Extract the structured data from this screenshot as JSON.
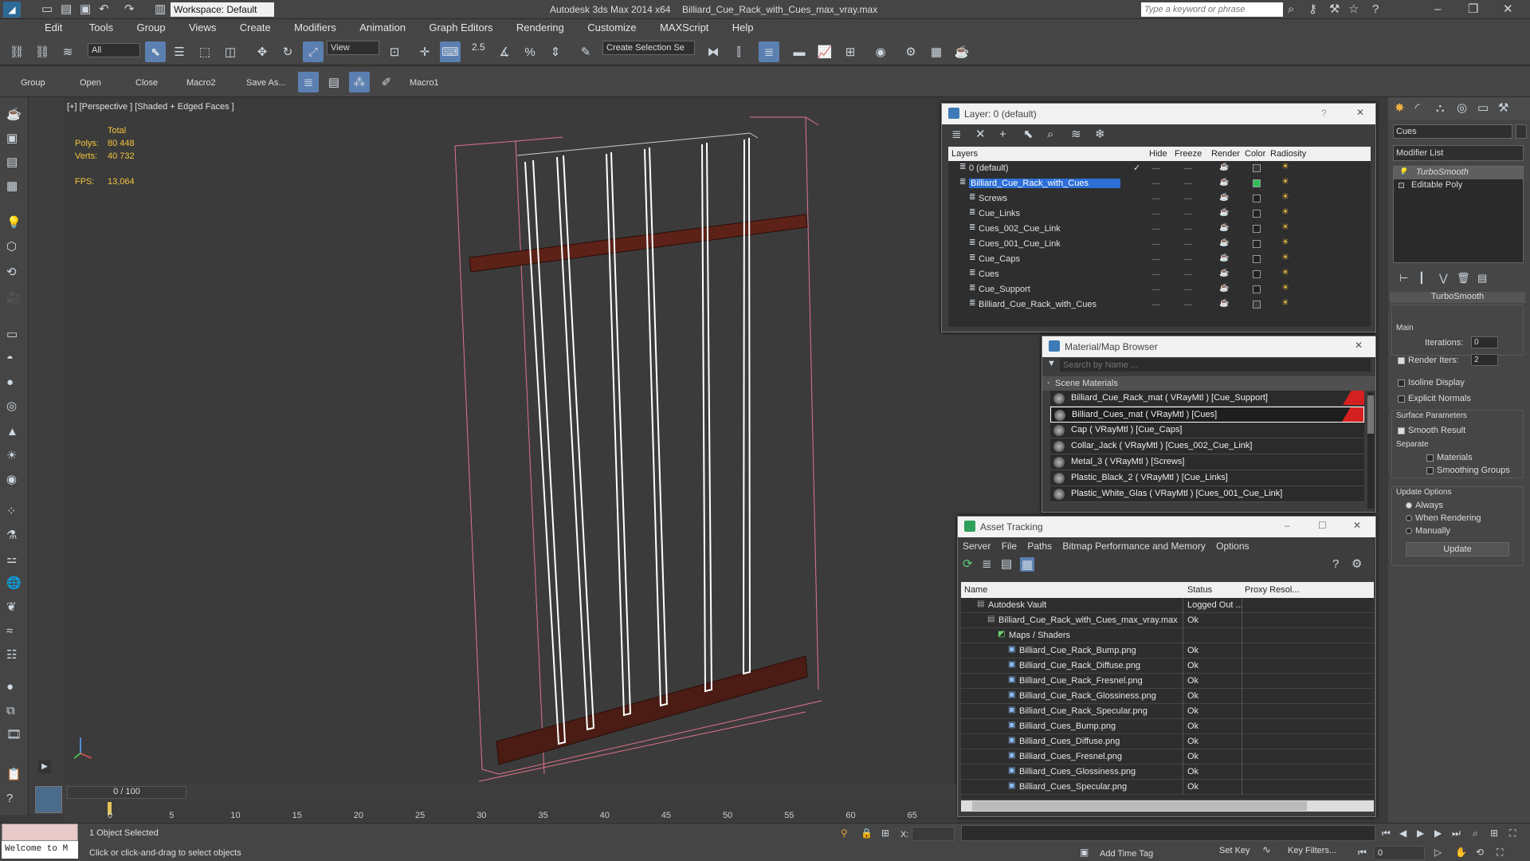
{
  "titlebar": {
    "app_title": "Autodesk 3ds Max  2014 x64",
    "file_title": "Billiard_Cue_Rack_with_Cues_max_vray.max",
    "workspace": "Workspace: Default",
    "search_placeholder": "Type a keyword or phrase"
  },
  "menu": [
    "Edit",
    "Tools",
    "Group",
    "Views",
    "Create",
    "Modifiers",
    "Animation",
    "Graph Editors",
    "Rendering",
    "Customize",
    "MAXScript",
    "Help"
  ],
  "toolbar": {
    "selection_filter": "All",
    "ref_coord": "View",
    "snap_value": "2.5",
    "named_selection": "Create Selection Se"
  },
  "ribbon": {
    "items": [
      "Group",
      "Open",
      "Close",
      "Macro2",
      "Save As...",
      "Macro1"
    ]
  },
  "viewport": {
    "label": "[+] [Perspective ] [Shaded + Edged Faces ]",
    "stats_header": "Total",
    "polys_label": "Polys:",
    "polys": "80 448",
    "verts_label": "Verts:",
    "verts": "40 732",
    "fps_label": "FPS:",
    "fps": "13,064"
  },
  "layer_window": {
    "title": "Layer: 0 (default)",
    "columns": [
      "Layers",
      "Hide",
      "Freeze",
      "Render",
      "Color",
      "Radiosity"
    ],
    "rows": [
      {
        "name": "0 (default)",
        "level": 0,
        "selected": false,
        "color": "#3a3a3a"
      },
      {
        "name": "Billiard_Cue_Rack_with_Cues",
        "level": 0,
        "selected": true,
        "color": "#2fbf5a"
      },
      {
        "name": "Screws",
        "level": 1,
        "selected": false,
        "color": "#222222"
      },
      {
        "name": "Cue_Links",
        "level": 1,
        "selected": false,
        "color": "#222222"
      },
      {
        "name": "Cues_002_Cue_Link",
        "level": 1,
        "selected": false,
        "color": "#222222"
      },
      {
        "name": "Cues_001_Cue_Link",
        "level": 1,
        "selected": false,
        "color": "#222222"
      },
      {
        "name": "Cue_Caps",
        "level": 1,
        "selected": false,
        "color": "#222222"
      },
      {
        "name": "Cues",
        "level": 1,
        "selected": false,
        "color": "#222222"
      },
      {
        "name": "Cue_Support",
        "level": 1,
        "selected": false,
        "color": "#222222"
      },
      {
        "name": "Billiard_Cue_Rack_with_Cues",
        "level": 1,
        "selected": false,
        "color": "#3a3a3a"
      }
    ]
  },
  "material_browser": {
    "title": "Material/Map Browser",
    "search_placeholder": "Search by Name ...",
    "section": "Scene Materials",
    "items": [
      {
        "label": "Billiard_Cue_Rack_mat  ( VRayMtl ) [Cue_Support]",
        "flag": true,
        "selected": false
      },
      {
        "label": "Billiard_Cues_mat  ( VRayMtl ) [Cues]",
        "flag": true,
        "selected": true
      },
      {
        "label": "Cap  ( VRayMtl ) [Cue_Caps]",
        "flag": false,
        "selected": false
      },
      {
        "label": "Collar_Jack  ( VRayMtl ) [Cues_002_Cue_Link]",
        "flag": false,
        "selected": false
      },
      {
        "label": "Metal_3  ( VRayMtl ) [Screws]",
        "flag": false,
        "selected": false
      },
      {
        "label": "Plastic_Black_2  ( VRayMtl ) [Cue_Links]",
        "flag": false,
        "selected": false
      },
      {
        "label": "Plastic_White_Glas  ( VRayMtl ) [Cues_001_Cue_Link]",
        "flag": false,
        "selected": false
      }
    ]
  },
  "asset_tracking": {
    "title": "Asset Tracking",
    "menu": [
      "Server",
      "File",
      "Paths",
      "Bitmap Performance and Memory",
      "Options"
    ],
    "columns": [
      "Name",
      "Status",
      "Proxy Resol..."
    ],
    "rows": [
      {
        "name": "Autodesk Vault",
        "status": "Logged Out ...",
        "level": 0
      },
      {
        "name": "Billiard_Cue_Rack_with_Cues_max_vray.max",
        "status": "Ok",
        "level": 1
      },
      {
        "name": "Maps / Shaders",
        "status": "",
        "level": 2
      },
      {
        "name": "Billiard_Cue_Rack_Bump.png",
        "status": "Ok",
        "level": 3
      },
      {
        "name": "Billiard_Cue_Rack_Diffuse.png",
        "status": "Ok",
        "level": 3
      },
      {
        "name": "Billiard_Cue_Rack_Fresnel.png",
        "status": "Ok",
        "level": 3
      },
      {
        "name": "Billiard_Cue_Rack_Glossiness.png",
        "status": "Ok",
        "level": 3
      },
      {
        "name": "Billiard_Cue_Rack_Specular.png",
        "status": "Ok",
        "level": 3
      },
      {
        "name": "Billiard_Cues_Bump.png",
        "status": "Ok",
        "level": 3
      },
      {
        "name": "Billiard_Cues_Diffuse.png",
        "status": "Ok",
        "level": 3
      },
      {
        "name": "Billiard_Cues_Fresnel.png",
        "status": "Ok",
        "level": 3
      },
      {
        "name": "Billiard_Cues_Glossiness.png",
        "status": "Ok",
        "level": 3
      },
      {
        "name": "Billiard_Cues_Specular.png",
        "status": "Ok",
        "level": 3
      }
    ]
  },
  "command_panel": {
    "object_name": "Cues",
    "modifier_list": "Modifier List",
    "stack": [
      "TurboSmooth",
      "Editable Poly"
    ],
    "rollout_title": "TurboSmooth",
    "main_label": "Main",
    "iterations_label": "Iterations:",
    "iterations": "0",
    "render_iters_label": "Render Iters:",
    "render_iters": "2",
    "isoline": "Isoline Display",
    "explicit_normals": "Explicit Normals",
    "surface_params": "Surface Parameters",
    "smooth_result": "Smooth Result",
    "separate": "Separate",
    "materials": "Materials",
    "smoothing_groups": "Smoothing Groups",
    "update_options": "Update Options",
    "always": "Always",
    "when_rendering": "When Rendering",
    "manually": "Manually",
    "update_button": "Update"
  },
  "timeline": {
    "frame": "0 / 100",
    "ticks": [
      "0",
      "5",
      "10",
      "15",
      "20",
      "25",
      "30",
      "35",
      "40",
      "45",
      "50",
      "55",
      "60",
      "65"
    ]
  },
  "status": {
    "welcome": "Welcome to M",
    "selected": "1 Object Selected",
    "prompt": "Click or click-and-drag to select objects",
    "x_label": "X:",
    "add_time_tag": "Add Time Tag",
    "set_key": "Set Key",
    "key_filters": "Key Filters...",
    "frame_value": "0"
  },
  "colors": {
    "accent": "#5b7fb0",
    "selection": "#2d6fd6",
    "timeline_marker": "#e2c35a",
    "cue_wire": "#ffffff",
    "rack_wood": "#5c2218",
    "bbox_pink": "#e0748c"
  }
}
